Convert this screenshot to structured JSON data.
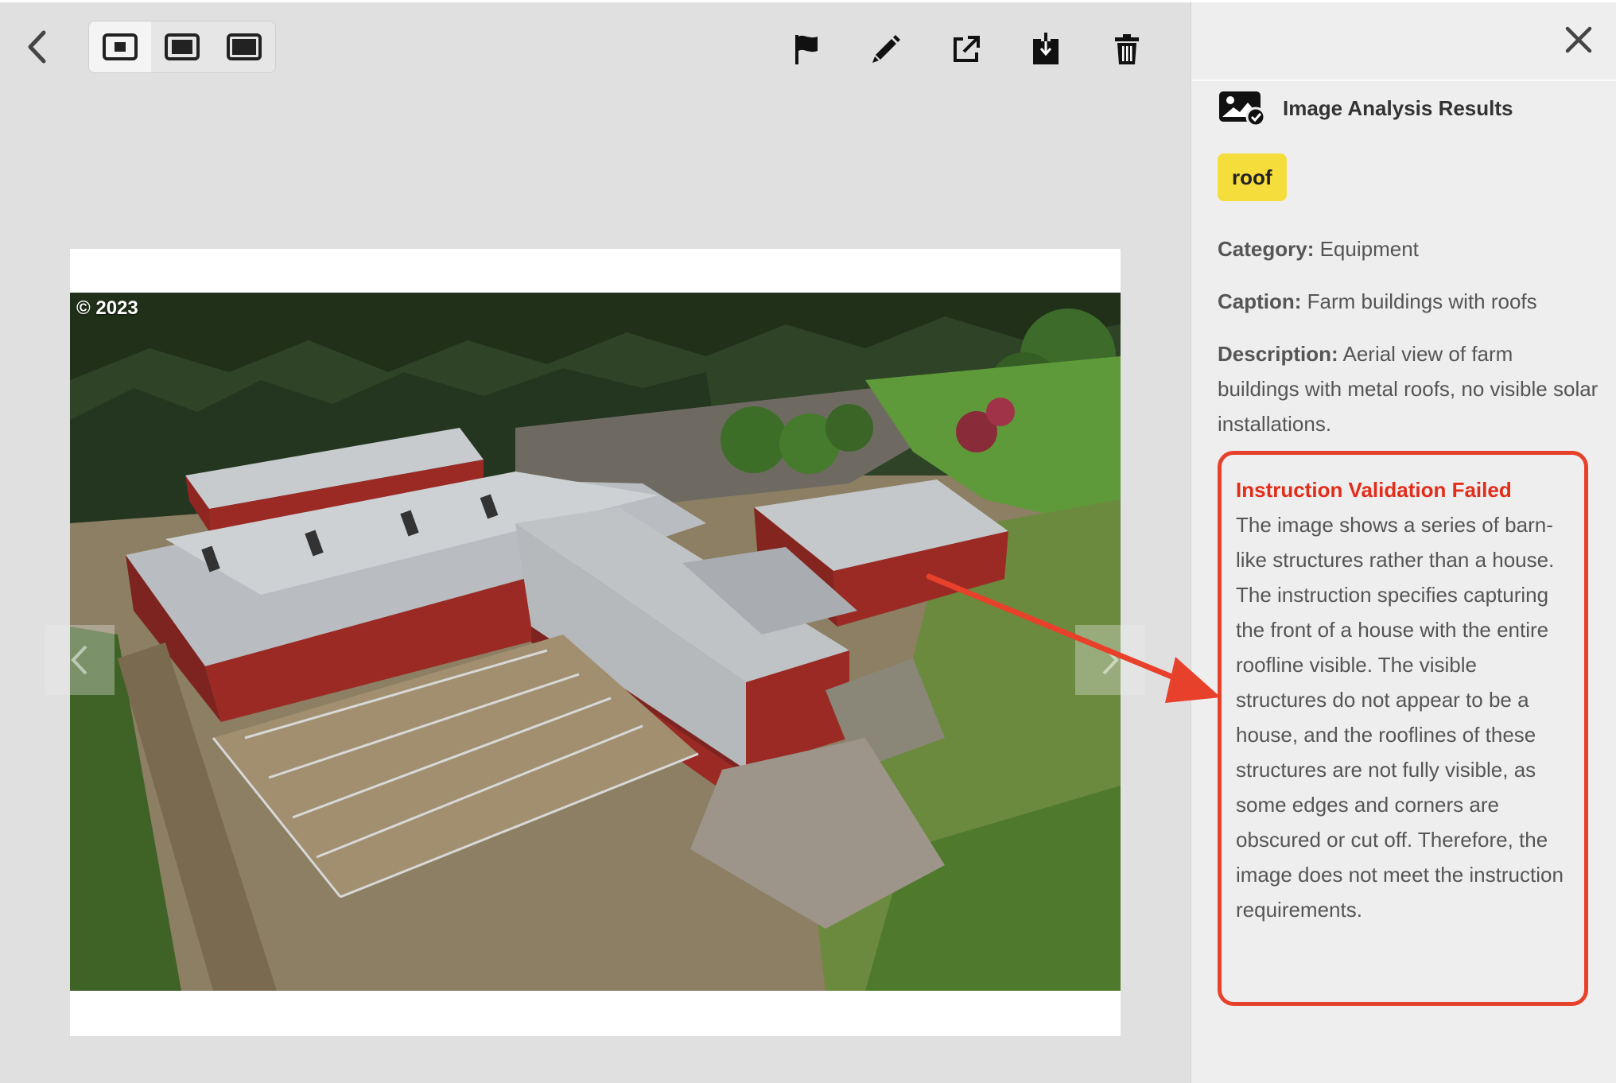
{
  "toolbar": {
    "back_icon": "chevron-left-icon",
    "view_sizes": [
      {
        "icon": "view-small-icon",
        "active": true
      },
      {
        "icon": "view-medium-icon",
        "active": false
      },
      {
        "icon": "view-large-icon",
        "active": false
      }
    ],
    "actions": [
      "flag-icon",
      "pencil-icon",
      "external-link-icon",
      "download-icon",
      "trash-icon"
    ]
  },
  "photo": {
    "copyright": "© 2023"
  },
  "panel": {
    "title": "Image Analysis Results",
    "tag": "roof",
    "category_label": "Category:",
    "category_value": "Equipment",
    "caption_label": "Caption:",
    "caption_value": "Farm buildings with roofs",
    "description_label": "Description:",
    "description_value": "Aerial view of farm buildings with metal roofs, no visible solar installations.",
    "validation_title": "Instruction Validation Failed",
    "validation_text": "The image shows a series of barn-like structures rather than a house. The instruction specifies capturing the front of a house with the entire roofline visible. The visible structures do not appear to be a house, and the rooflines of these structures are not fully visible, as some edges and corners are obscured or cut off. Therefore, the image does not meet the instruction requirements."
  },
  "colors": {
    "tag_bg": "#f5dd3c",
    "alert": "#e8412b",
    "barn_red": "#9b2a25",
    "roof": "#b9bdc1"
  }
}
